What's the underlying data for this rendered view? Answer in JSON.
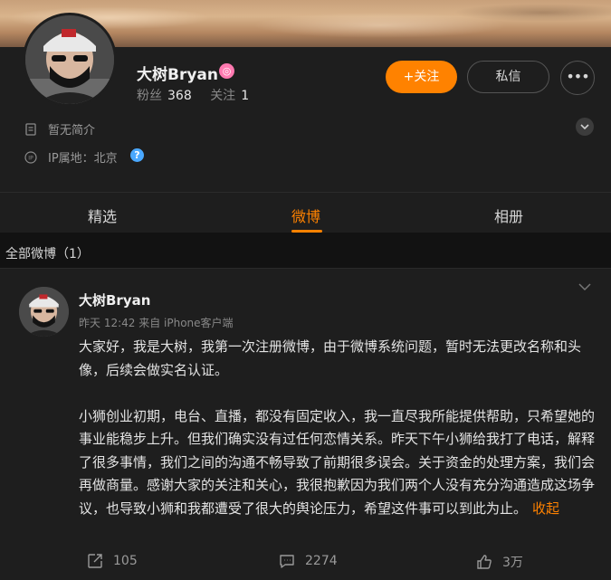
{
  "profile": {
    "name": "大树Bryan",
    "fans_label": "粉丝",
    "fans_count": "368",
    "follow_label": "关注",
    "follow_count": "1",
    "follow_button": "+关注",
    "message_button": "私信",
    "bio": "暂无简介",
    "ip_location": "IP属地：北京"
  },
  "tabs": [
    {
      "label": "精选"
    },
    {
      "label": "微博"
    },
    {
      "label": "相册"
    }
  ],
  "feed": {
    "header": "全部微博（1）"
  },
  "post": {
    "author": "大树Bryan",
    "meta": "昨天 12:42  来自 iPhone客户端",
    "paragraph1": "大家好，我是大树，我第一次注册微博，由于微博系统问题，暂时无法更改名称和头像，后续会做实名认证。",
    "paragraph2": "小狮创业初期，电台、直播，都没有固定收入，我一直尽我所能提供帮助，只希望她的事业能稳步上升。但我们确实没有过任何恋情关系。昨天下午小狮给我打了电话，解释了很多事情，我们之间的沟通不畅导致了前期很多误会。关于资金的处理方案，我们会再做商量。感谢大家的关注和关心，我很抱歉因为我们两个人没有充分沟通造成这场争议，也导致小狮和我都遭受了很大的舆论压力，希望这件事可以到此为止。",
    "collapse_label": "收起",
    "reposts": "105",
    "comments": "2274",
    "likes": "3万"
  },
  "colors": {
    "accent": "#ff8200",
    "background": "#121212",
    "card": "#1e1e1e"
  }
}
